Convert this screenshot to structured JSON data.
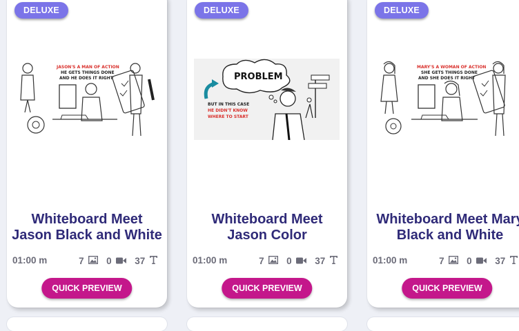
{
  "cards": [
    {
      "badge": "DELUXE",
      "title_line1": "Whiteboard Meet",
      "title_line2": "Jason Black and White",
      "duration": "01:00 m",
      "images": "7",
      "videos": "0",
      "texts": "37",
      "button": "QUICK PREVIEW",
      "thumb_caption_1": "JASON'S A MAN OF ACTION",
      "thumb_caption_2": "HE GETS THINGS DONE",
      "thumb_caption_3": "AND HE DOES IT RIGHT"
    },
    {
      "badge": "DELUXE",
      "title_line1": "Whiteboard Meet",
      "title_line2": "Jason Color",
      "duration": "01:00 m",
      "images": "7",
      "videos": "0",
      "texts": "37",
      "button": "QUICK PREVIEW",
      "thumb_bubble": "PROBLEM",
      "thumb_caption_1": "BUT IN THIS CASE",
      "thumb_caption_2": "HE DIDN'T KNOW",
      "thumb_caption_3": "WHERE TO START"
    },
    {
      "badge": "DELUXE",
      "title_line1": "Whiteboard Meet Mary",
      "title_line2": "Black and White",
      "duration": "01:00 m",
      "images": "7",
      "videos": "0",
      "texts": "37",
      "button": "QUICK PREVIEW",
      "thumb_caption_1": "MARY'S A WOMAN OF ACTION",
      "thumb_caption_2": "SHE GETS THINGS DONE",
      "thumb_caption_3": "AND SHE DOES IT RIGHT"
    }
  ],
  "icons": {
    "images": "image-icon",
    "videos": "video-camera-icon",
    "texts": "text-icon"
  },
  "colors": {
    "badge": "#7b74e8",
    "title": "#2f2a78",
    "button": "#c4178b",
    "caption_red": "#d9302c"
  }
}
